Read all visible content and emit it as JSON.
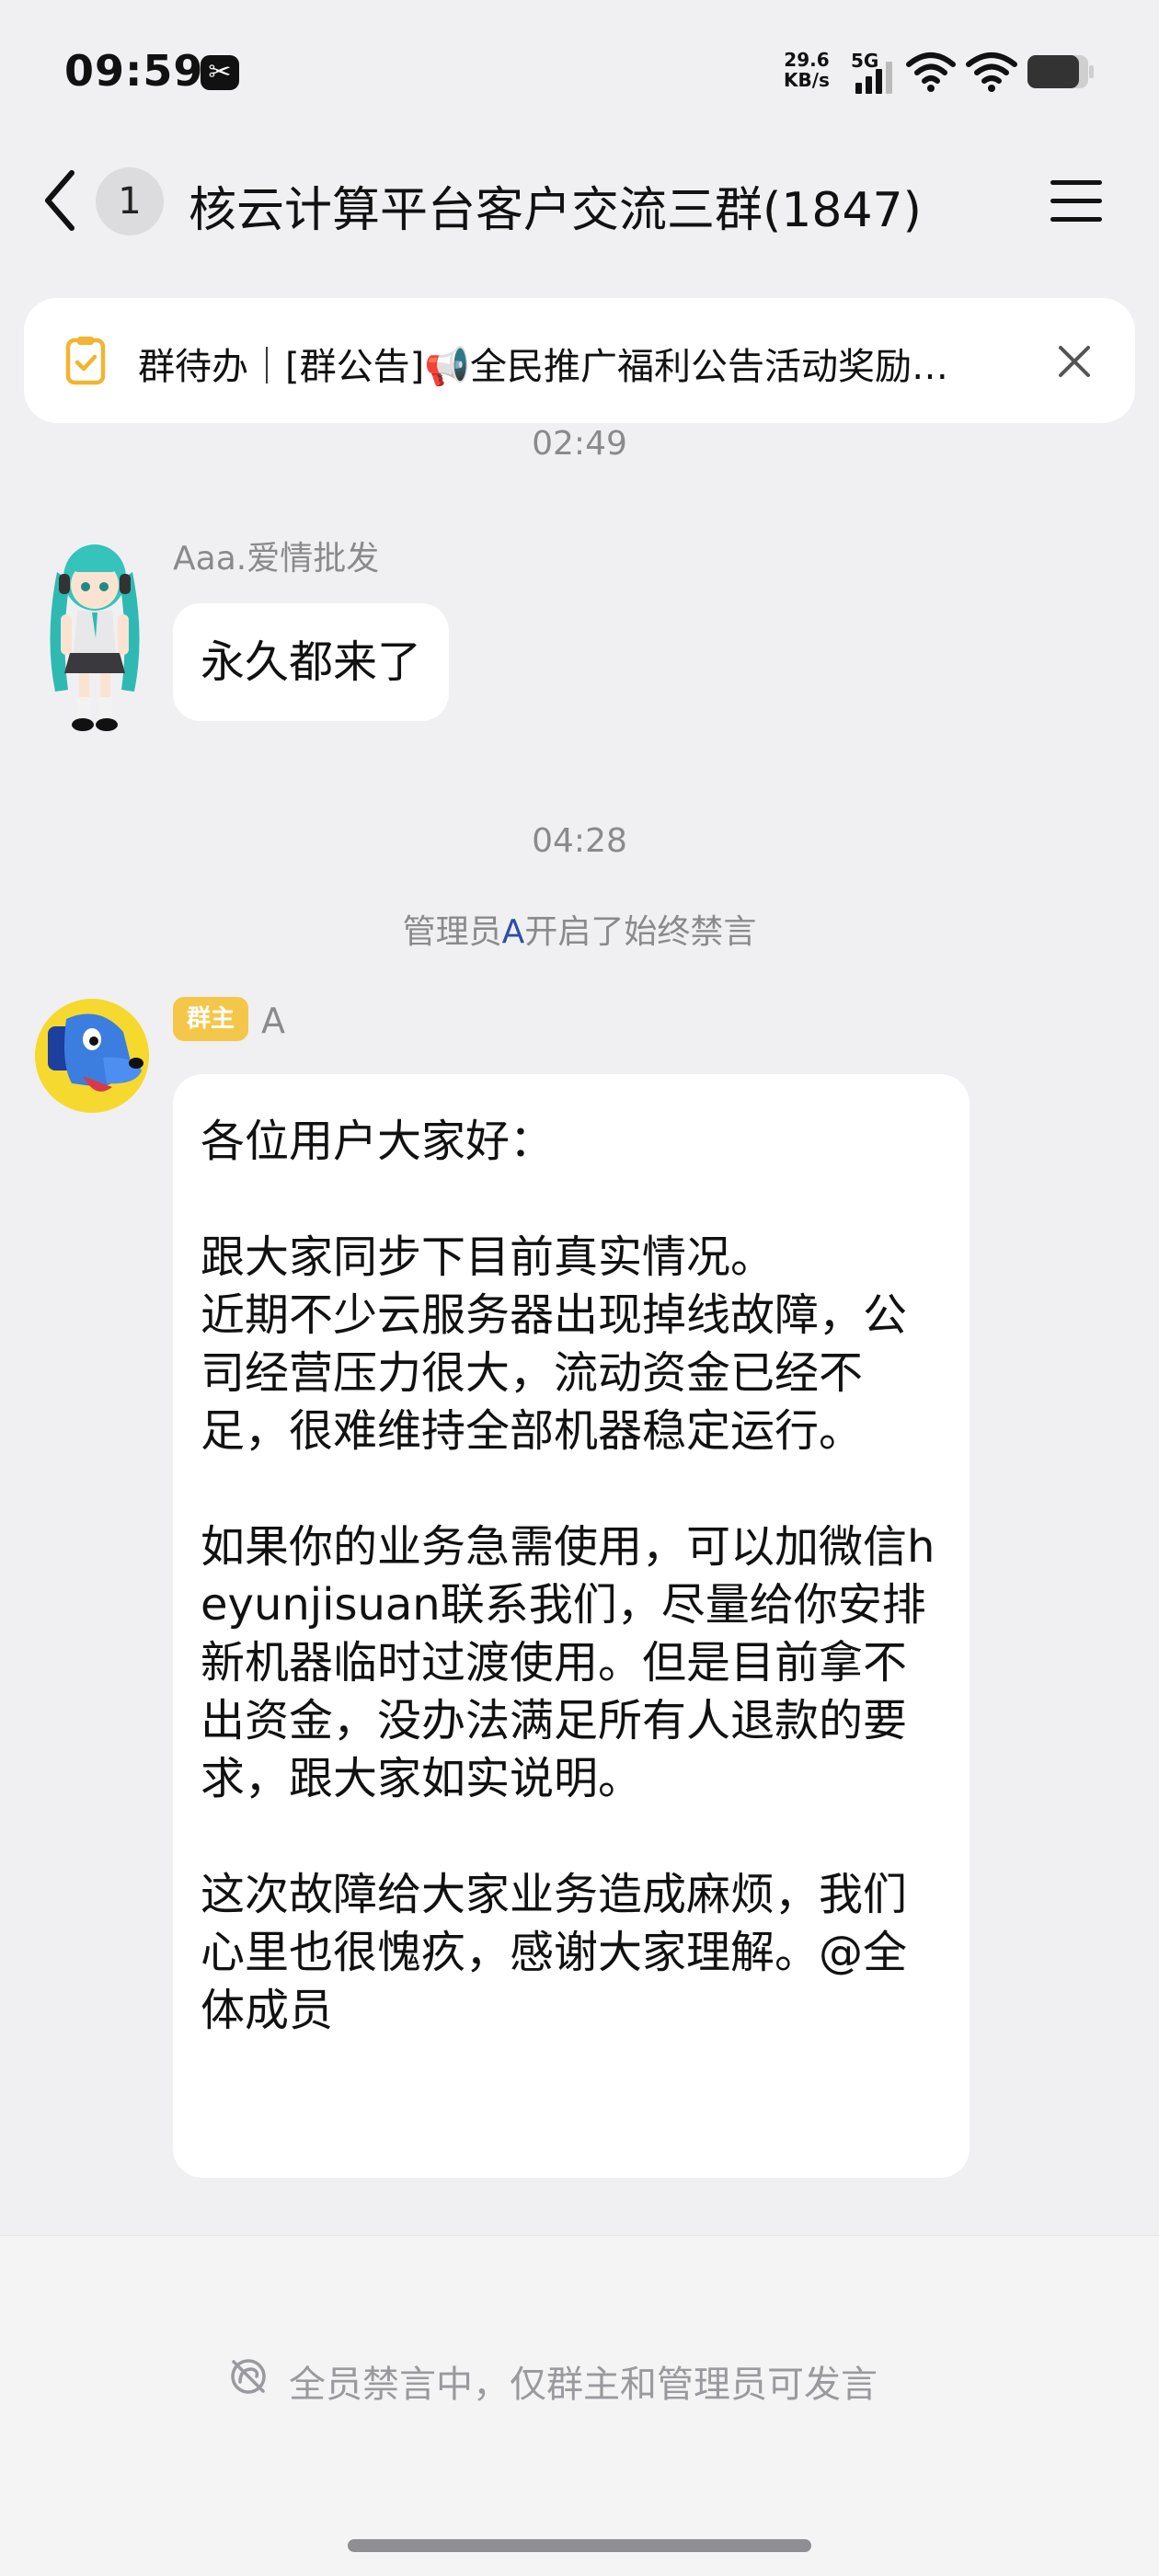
{
  "status_bar": {
    "time": "09:59",
    "net_speed_value": "29.6",
    "net_speed_unit": "KB/s",
    "network_type": "5G"
  },
  "header": {
    "unread_count": "1",
    "title": "核云计算平台客户交流三群(1847)"
  },
  "todo_bar": {
    "text": "群待办｜[群公告]📢全民推广福利公告活动奖励…"
  },
  "messages": {
    "time_1": "02:49",
    "msg_1": {
      "sender": "Aaa.爱情批发",
      "text": "永久都来了"
    },
    "time_2": "04:28",
    "system_notice": {
      "prefix": "管理员",
      "admin": "A",
      "suffix": "开启了始终禁言"
    },
    "msg_2": {
      "badge": "群主",
      "sender": "A",
      "text": "各位用户大家好：\n\n跟大家同步下目前真实情况。\n近期不少云服务器出现掉线故障，公司经营压力很大，流动资金已经不足，很难维持全部机器稳定运行。\n\n如果你的业务急需使用，可以加微信heyunjisuan联系我们，尽量给你安排新机器临时过渡使用。但是目前拿不出资金，没办法满足所有人退款的要求，跟大家如实说明。\n\n这次故障给大家业务造成麻烦，我们心里也很愧疚，感谢大家理解。@全体成员"
    }
  },
  "footer": {
    "mute_text": "全员禁言中，仅群主和管理员可发言"
  },
  "icons": {
    "back": "chevron-left-icon",
    "menu": "hamburger-menu-icon",
    "todo": "todo-clipboard-icon",
    "close": "close-icon",
    "mute": "mute-icon"
  },
  "colors": {
    "background": "#f0f0f2",
    "bubble": "#ffffff",
    "owner_badge": "#f4c74a",
    "admin_link": "#2c4fa6",
    "todo_icon": "#f2b431"
  }
}
